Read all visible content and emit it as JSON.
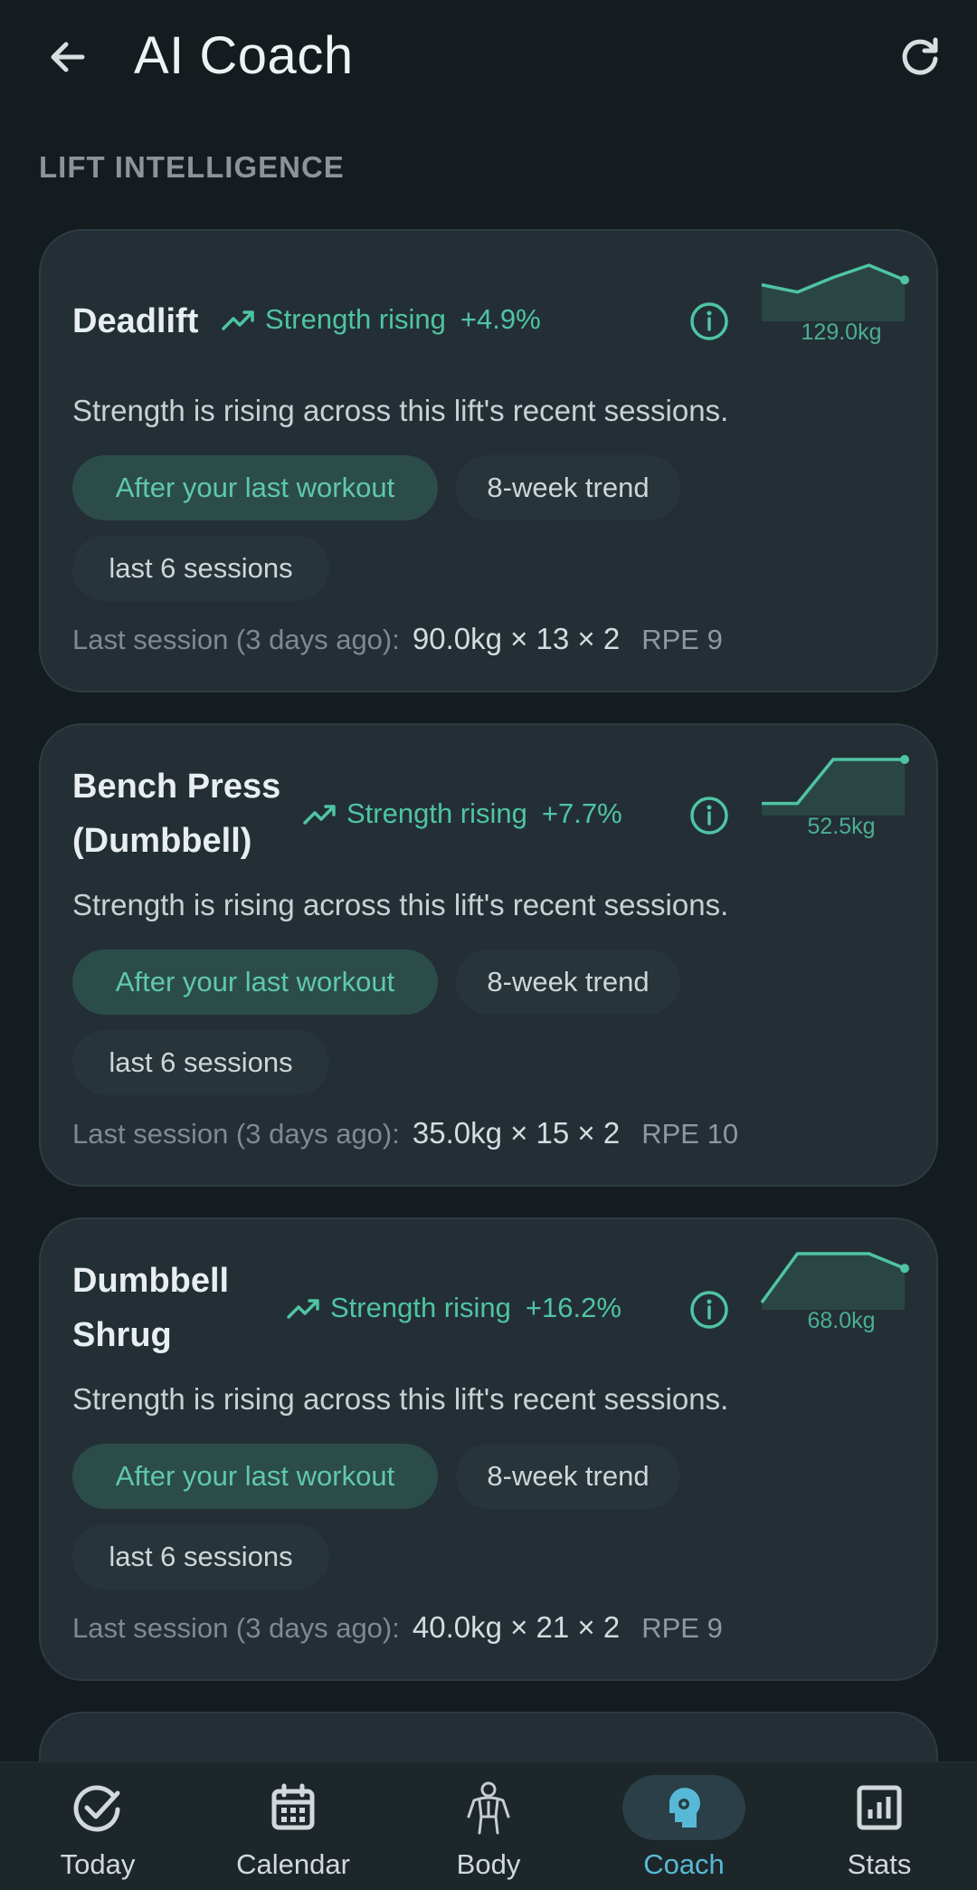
{
  "header": {
    "title": "AI Coach",
    "back_icon": "arrow-left-icon",
    "refresh_icon": "refresh-icon"
  },
  "section_label": "LIFT INTELLIGENCE",
  "colors": {
    "accent": "#4fc4a4",
    "background": "#141c20",
    "card": "#232f35",
    "nav_active": "#58b9d6"
  },
  "cards": [
    {
      "name_lines": [
        "Deadlift"
      ],
      "trend_label": "Strength rising",
      "trend_pct": "+4.9%",
      "sparkline": [
        0.6,
        0.45,
        0.75,
        1.0,
        0.7
      ],
      "sparkline_value": "129.0kg",
      "summary": "Strength is rising across this lift's recent sessions.",
      "chips": [
        "After your last workout",
        "8-week trend",
        "last 6 sessions"
      ],
      "last_label": "Last session (3 days ago):",
      "last_value": "90.0kg × 13 × 2",
      "last_rpe": "RPE 9"
    },
    {
      "name_lines": [
        "Bench Press",
        "(Dumbbell)"
      ],
      "trend_label": "Strength rising",
      "trend_pct": "+7.7%",
      "sparkline": [
        0.1,
        0.1,
        1.0,
        1.0,
        1.0
      ],
      "sparkline_value": "52.5kg",
      "summary": "Strength is rising across this lift's recent sessions.",
      "chips": [
        "After your last workout",
        "8-week trend",
        "last 6 sessions"
      ],
      "last_label": "Last session (3 days ago):",
      "last_value": "35.0kg × 15 × 2",
      "last_rpe": "RPE 10"
    },
    {
      "name_lines": [
        "Dumbbell",
        "Shrug"
      ],
      "trend_label": "Strength rising",
      "trend_pct": "+16.2%",
      "sparkline": [
        0.0,
        1.0,
        1.0,
        1.0,
        0.7
      ],
      "sparkline_value": "68.0kg",
      "summary": "Strength is rising across this lift's recent sessions.",
      "chips": [
        "After your last workout",
        "8-week trend",
        "last 6 sessions"
      ],
      "last_label": "Last session (3 days ago):",
      "last_value": "40.0kg × 21 × 2",
      "last_rpe": "RPE 9"
    }
  ],
  "nav": [
    {
      "label": "Today",
      "icon": "check-circle-icon",
      "active": false
    },
    {
      "label": "Calendar",
      "icon": "calendar-icon",
      "active": false
    },
    {
      "label": "Body",
      "icon": "body-icon",
      "active": false
    },
    {
      "label": "Coach",
      "icon": "coach-brain-icon",
      "active": true
    },
    {
      "label": "Stats",
      "icon": "stats-icon",
      "active": false
    }
  ]
}
